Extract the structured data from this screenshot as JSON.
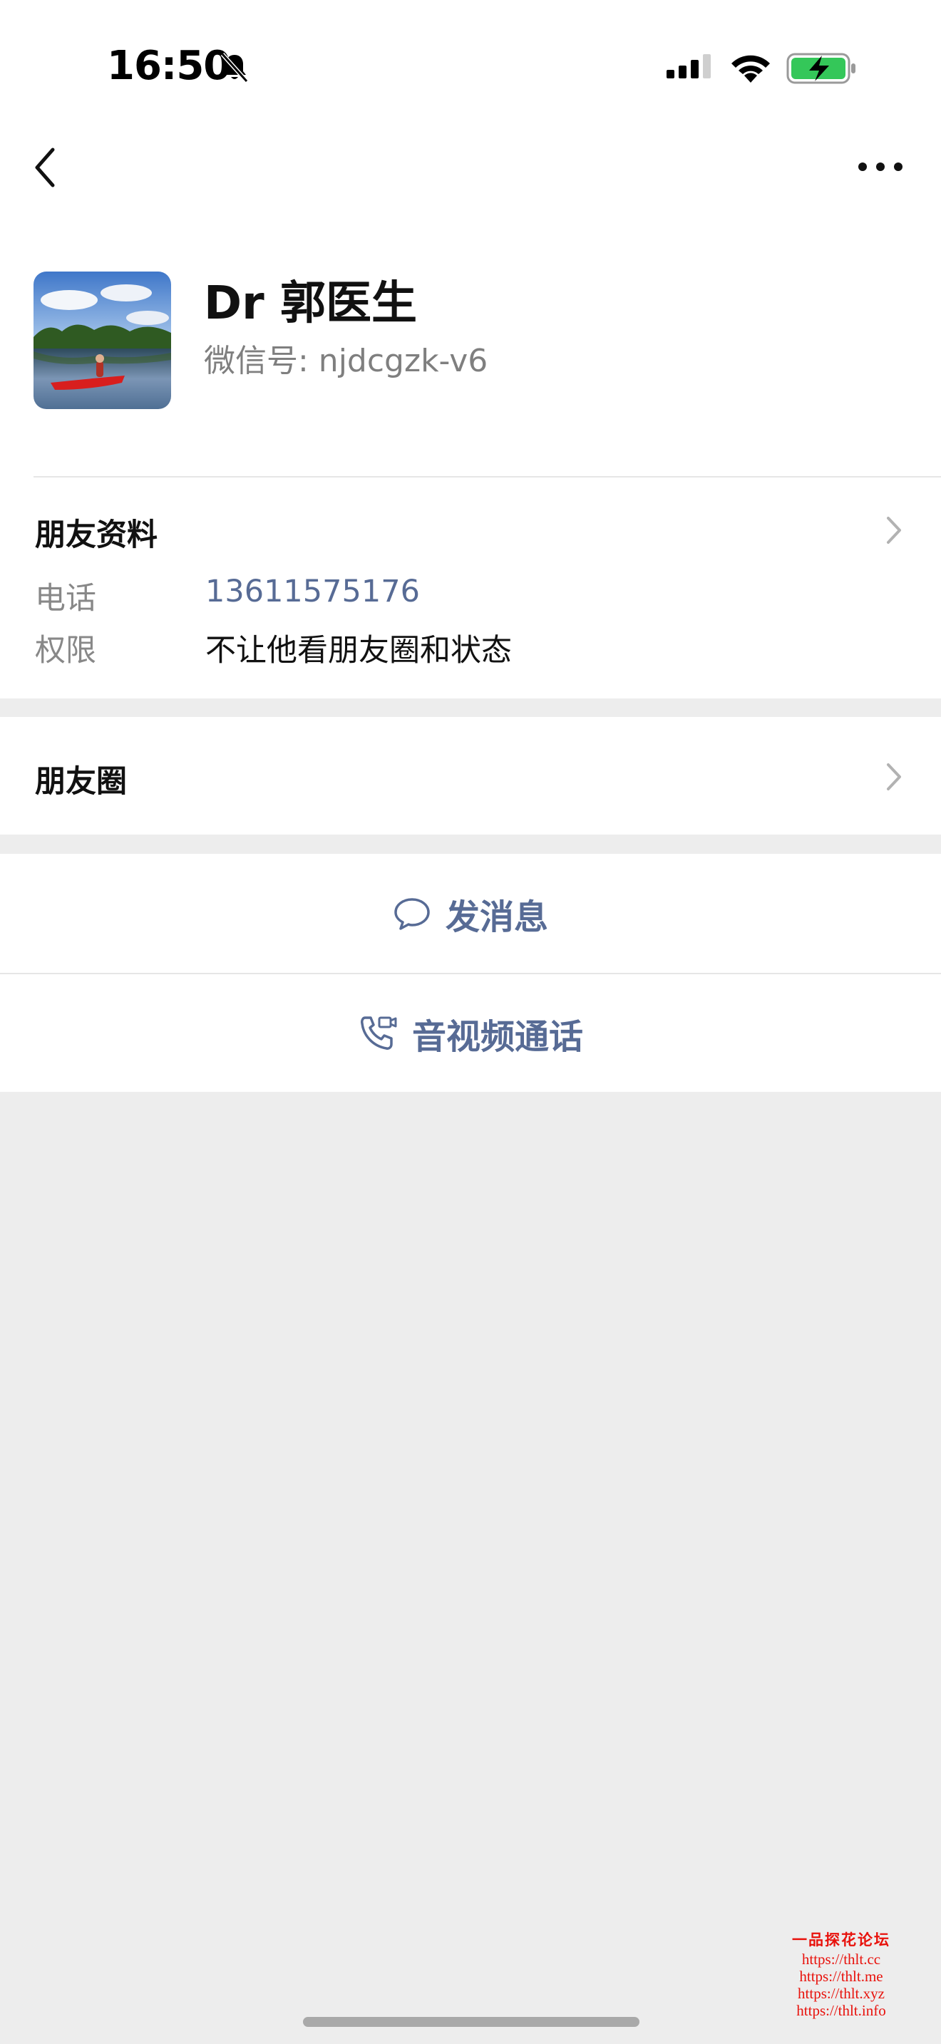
{
  "status_bar": {
    "time": "16:50",
    "icons": [
      "bell-slash-icon",
      "cellular-signal-icon",
      "wifi-icon",
      "battery-charging-icon"
    ]
  },
  "nav": {
    "back_icon": "chevron-left-icon",
    "more_icon": "ellipsis-icon"
  },
  "profile": {
    "name": "Dr 郭医生",
    "wechat_id": "微信号: njdcgzk-v6"
  },
  "friend_info": {
    "title": "朋友资料",
    "phone_label": "电话",
    "phone_value": "13611575176",
    "permission_label": "权限",
    "permission_value": "不让他看朋友圈和状态"
  },
  "moments": {
    "title": "朋友圈"
  },
  "actions": {
    "message_label": "发消息",
    "call_label": "音视频通话"
  },
  "watermark": {
    "title": "一品探花论坛",
    "urls": [
      "https://thlt.cc",
      "https://thlt.me",
      "https://thlt.xyz",
      "https://thlt.info"
    ]
  },
  "colors": {
    "link": "#576b95",
    "background": "#ededed",
    "battery_green": "#34c759",
    "watermark_red": "#e8120c"
  }
}
